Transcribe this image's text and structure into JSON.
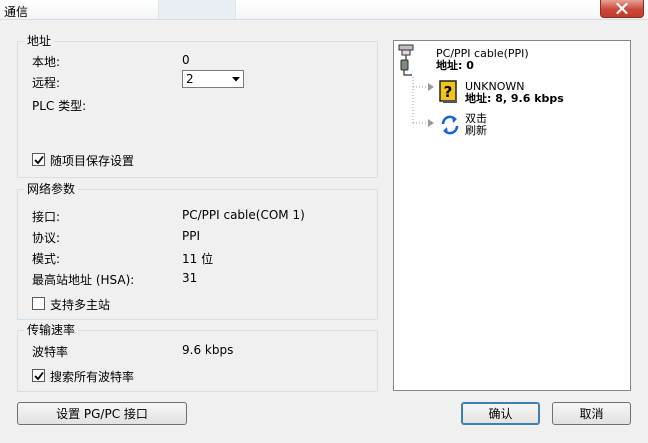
{
  "window": {
    "title": "通信"
  },
  "address": {
    "legend": "地址",
    "local_label": "本地:",
    "local_value": "0",
    "remote_label": "远程:",
    "remote_value": "2",
    "plc_type_label": "PLC 类型:",
    "save_with_project_label": "随项目保存设置",
    "save_with_project_checked": true
  },
  "network": {
    "legend": "网络参数",
    "interface_label": "接口:",
    "interface_value": "PC/PPI cable(COM 1)",
    "protocol_label": "协议:",
    "protocol_value": "PPI",
    "mode_label": "模式:",
    "mode_value": "11 位",
    "hsa_label": "最高站地址 (HSA):",
    "hsa_value": "31",
    "multi_master_label": "支持多主站",
    "multi_master_checked": false
  },
  "transmission": {
    "legend": "传输速率",
    "baud_label": "波特率",
    "baud_value": "9.6 kbps",
    "search_all_label": "搜索所有波特率",
    "search_all_checked": true
  },
  "tree": {
    "cable_name": "PC/PPI cable(PPI)",
    "cable_address": "地址: 0",
    "device_name": "UNKNOWN",
    "device_address": "地址: 8, 9.6 kbps",
    "refresh_line1": "双击",
    "refresh_line2": "刷新"
  },
  "buttons": {
    "setup_pgpc": "设置 PG/PC 接口",
    "ok": "确认",
    "cancel": "取消"
  },
  "icons": {
    "close": "close-icon",
    "dropdown": "chevron-down-icon",
    "cable": "pc-ppi-cable-icon",
    "unknown_device": "unknown-device-icon",
    "refresh": "refresh-icon"
  },
  "colors": {
    "close_button": "#c9483a",
    "refresh_icon": "#1a62d6",
    "unknown_device": "#f0c419"
  }
}
